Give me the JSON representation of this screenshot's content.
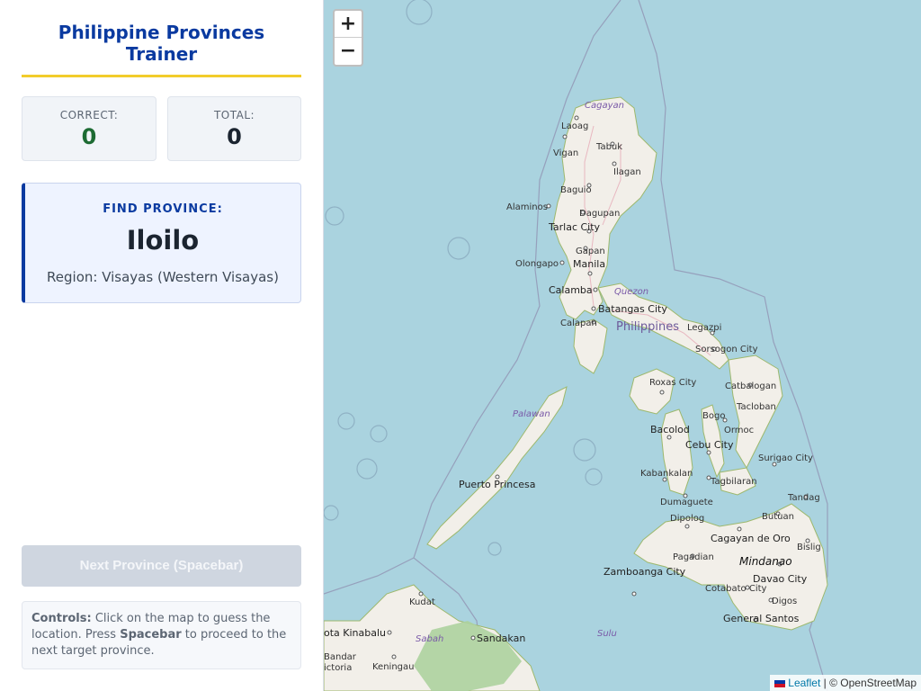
{
  "app": {
    "title": "Philippine Provinces Trainer"
  },
  "stats": {
    "correct_label": "CORRECT:",
    "correct_value": "0",
    "total_label": "TOTAL:",
    "total_value": "0"
  },
  "target": {
    "label": "FIND PROVINCE:",
    "name": "Iloilo",
    "region": "Region: Visayas (Western Visayas)"
  },
  "next_button": {
    "label": "Next Province (Spacebar)",
    "enabled": false
  },
  "controls": {
    "heading": "Controls:",
    "text1": "Click on the map to guess the location. Press",
    "key": "Spacebar",
    "text2": "to proceed to the next target province."
  },
  "map": {
    "zoom_in": "+",
    "zoom_out": "−",
    "attribution_leaflet": "Leaflet",
    "attribution_sep": "|",
    "attribution_osm": "© OpenStreetMap",
    "country_label": "Philippines",
    "places": {
      "cagayan": "Cagayan",
      "laoag": "Laoag",
      "tabuk": "Tabuk",
      "vigan": "Vigan",
      "ilagan": "Ilagan",
      "baguio": "Baguio",
      "alaminos": "Alaminos",
      "dagupan": "Dagupan",
      "tarlac": "Tarlac City",
      "gapan": "Gapan",
      "olongapo": "Olongapo",
      "manila": "Manila",
      "calamba": "Calamba",
      "quezon": "Quezon",
      "batangas": "Batangas City",
      "calapan": "Calapan",
      "legazpi": "Legazpi",
      "sorsogon": "Sorsogon City",
      "roxas": "Roxas City",
      "catbalogan": "Catbalogan",
      "palawan": "Palawan",
      "tacloban": "Tacloban",
      "bogo": "Bogo",
      "bacolod": "Bacolod",
      "ormoc": "Ormoc",
      "cebu": "Cebu City",
      "surigao": "Surigao City",
      "kabankalan": "Kabankalan",
      "tagbilaran": "Tagbilaran",
      "puerto_princesa": "Puerto Princesa",
      "dumaguete": "Dumaguete",
      "tandag": "Tandag",
      "dipolog": "Dipolog",
      "butuan": "Butuan",
      "cagayan_de_oro": "Cagayan de Oro",
      "pagadian": "Pagadian",
      "bislig": "Bislig",
      "mindanao": "Mindanao",
      "zamboanga": "Zamboanga City",
      "cotabato": "Cotabato City",
      "davao": "Davao City",
      "kudat": "Kudat",
      "digos": "Digos",
      "general_santos": "General Santos",
      "kota_kinabalu": "ota Kinabalu",
      "sabah": "Sabah",
      "sandakan": "Sandakan",
      "sulu": "Sulu",
      "keningau": "Keningau",
      "bandar": "Bandar",
      "victoria": "ictoria"
    }
  }
}
